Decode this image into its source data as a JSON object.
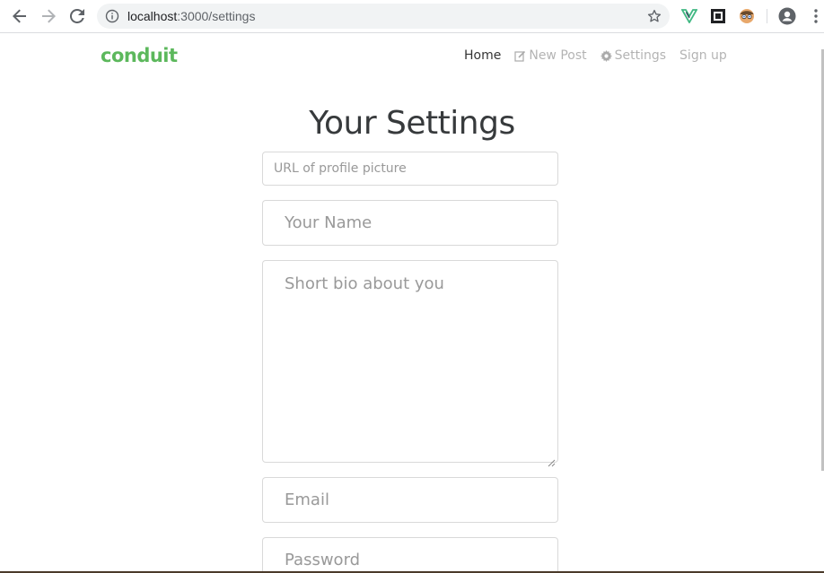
{
  "browser": {
    "url_host": "localhost",
    "url_path": ":3000/settings"
  },
  "navbar": {
    "brand": "conduit",
    "links": [
      {
        "label": "Home",
        "icon": "none"
      },
      {
        "label": "New Post",
        "icon": "compose-icon"
      },
      {
        "label": "Settings",
        "icon": "gear-icon"
      },
      {
        "label": "Sign up",
        "icon": "none"
      }
    ]
  },
  "settings": {
    "title": "Your Settings",
    "image_placeholder": "URL of profile picture",
    "name_placeholder": "Your Name",
    "bio_placeholder": "Short bio about you",
    "email_placeholder": "Email",
    "password_placeholder": "Password"
  },
  "colors": {
    "brand": "#5cb85c",
    "nav_active": "#333333",
    "nav_inactive": "#aaaaaa",
    "placeholder": "#999999"
  }
}
